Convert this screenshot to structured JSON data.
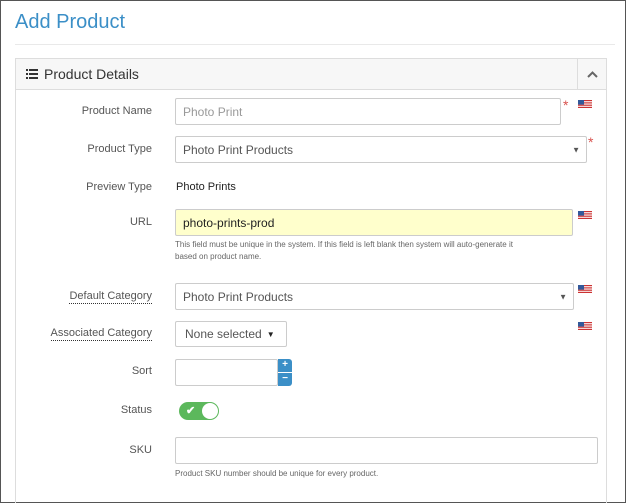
{
  "page": {
    "title": "Add Product"
  },
  "panel": {
    "title": "Product Details"
  },
  "fields": {
    "product_name": {
      "label": "Product Name",
      "placeholder": "Photo Print",
      "required": "*"
    },
    "product_type": {
      "label": "Product Type",
      "value": "Photo Print Products",
      "required": "*"
    },
    "preview_type": {
      "label": "Preview Type",
      "value": "Photo Prints"
    },
    "url": {
      "label": "URL",
      "value": "photo-prints-prod",
      "help_line1": "This field must be unique in the system. If this field is left blank then system will auto-generate it",
      "help_line2": "based on product name."
    },
    "default_category": {
      "label": "Default Category",
      "value": "Photo Print Products"
    },
    "associated_category": {
      "label": "Associated Category",
      "value": "None selected"
    },
    "sort": {
      "label": "Sort",
      "value": "",
      "up": "+",
      "down": "−"
    },
    "status": {
      "label": "Status",
      "on": true,
      "check": "✔"
    },
    "sku": {
      "label": "SKU",
      "value": "",
      "help": "Product SKU number should be unique for every product."
    }
  },
  "colors": {
    "accent": "#3b8fc7",
    "required": "#d9534f",
    "toggle_on": "#5cb85c",
    "url_bg": "#ffffcc"
  },
  "icons": {
    "panel": "list-icon",
    "collapse": "chevron-up-icon",
    "language": "us-flag-icon",
    "select": "caret-down-icon"
  }
}
